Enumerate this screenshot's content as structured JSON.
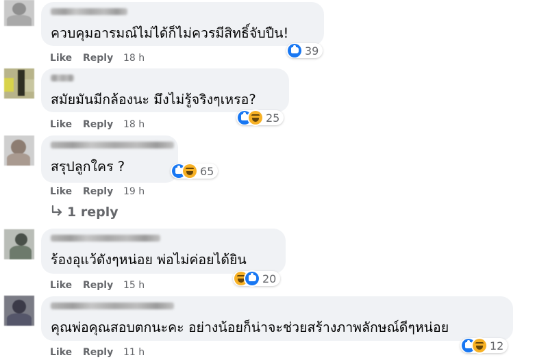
{
  "comments": [
    {
      "text": "ควบคุมอารมณ์ไม่ได้ก็ไม่ควรมีสิทธิ์จับปืน!",
      "reactions": [
        "like"
      ],
      "reaction_count": "39",
      "like_label": "Like",
      "reply_label": "Reply",
      "time": "18 h"
    },
    {
      "text": "สมัยมันมีกล้องนะ มึงไม่รู้จริงๆเหรอ?",
      "reactions": [
        "like",
        "haha"
      ],
      "reaction_count": "25",
      "like_label": "Like",
      "reply_label": "Reply",
      "time": "18 h"
    },
    {
      "text": "สรุปลูกใคร ?",
      "reactions": [
        "like",
        "haha"
      ],
      "reaction_count": "65",
      "like_label": "Like",
      "reply_label": "Reply",
      "time": "19 h",
      "replies_label": "1 reply"
    },
    {
      "text": "ร้องอุแว้ดังๆหน่อย พ่อไม่ค่อยได้ยิน",
      "reactions": [
        "haha",
        "like"
      ],
      "reaction_count": "20",
      "like_label": "Like",
      "reply_label": "Reply",
      "time": "15 h"
    },
    {
      "text": "คุณพ่อคุณสอบตกนะคะ อย่างน้อยก็น่าจะช่วยสร้างภาพลักษณ์ดีๆหน่อย",
      "reactions": [
        "like",
        "haha"
      ],
      "reaction_count": "12",
      "like_label": "Like",
      "reply_label": "Reply",
      "time": "11 h"
    }
  ],
  "colors": {
    "bubble": "#f0f2f5",
    "meta_text": "#65676b",
    "like_blue": "#1877f2",
    "haha_yellow": "#f7b125"
  },
  "icons": [
    "like-reaction-icon",
    "haha-reaction-icon",
    "reply-arrow-icon"
  ]
}
